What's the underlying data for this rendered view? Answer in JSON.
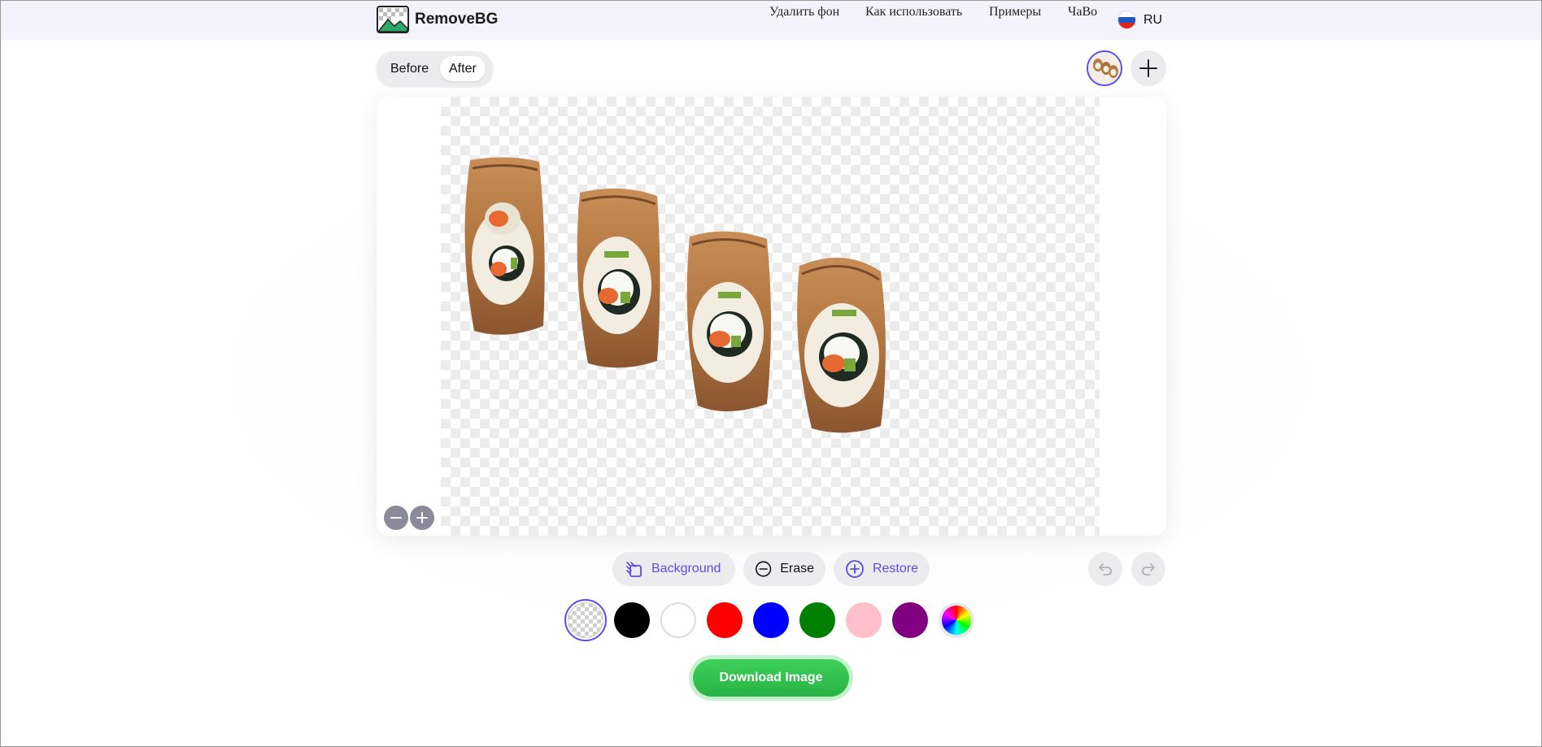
{
  "app": {
    "name": "RemoveBG"
  },
  "nav": {
    "items": [
      {
        "label": "Удалить фон"
      },
      {
        "label": "Как использовать"
      },
      {
        "label": "Примеры"
      },
      {
        "label": "ЧаВо"
      }
    ],
    "language": "RU"
  },
  "view_toggle": {
    "before_label": "Before",
    "after_label": "After",
    "selected": "After"
  },
  "tools": {
    "background_label": "Background",
    "erase_label": "Erase",
    "restore_label": "Restore"
  },
  "icons": {
    "logo": "image-landscape-icon",
    "add": "plus-icon",
    "zoom_out": "minus-circle-icon",
    "zoom_in": "plus-circle-icon",
    "background": "layers-icon",
    "erase": "minus-circle-icon",
    "restore": "plus-circle-icon",
    "undo": "undo-icon",
    "redo": "redo-icon",
    "flag": "russia-flag-icon"
  },
  "background_colors": [
    {
      "name": "transparent",
      "value": "transparent",
      "selected": true
    },
    {
      "name": "black",
      "value": "#000000"
    },
    {
      "name": "white",
      "value": "#ffffff"
    },
    {
      "name": "red",
      "value": "#ff0000"
    },
    {
      "name": "blue",
      "value": "#0000ff"
    },
    {
      "name": "green",
      "value": "#008000"
    },
    {
      "name": "pink",
      "value": "#ffc0cb"
    },
    {
      "name": "purple",
      "value": "#800080"
    },
    {
      "name": "custom",
      "value": "rainbow"
    }
  ],
  "download": {
    "label": "Download Image"
  },
  "colors": {
    "accent": "#5b4ce6",
    "download": "#2fbf4c",
    "header_bg": "#f4f3fd"
  }
}
